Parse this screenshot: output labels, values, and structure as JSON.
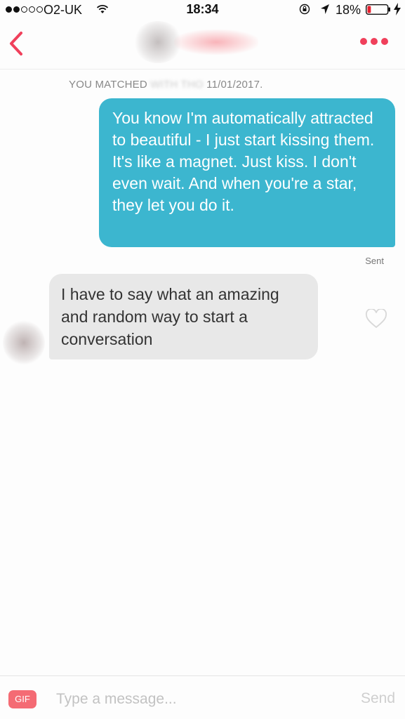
{
  "status_bar": {
    "carrier": "O2-UK",
    "time": "18:34",
    "battery_percent": "18%",
    "signal_strength": 2,
    "battery_level": 0.18
  },
  "header": {
    "back_icon": "chevron-left-icon",
    "more_icon": "more-dots-icon",
    "accent_color": "#f0405b"
  },
  "conversation": {
    "match_notice": {
      "prefix": "YOU MATCHED ",
      "obscured": "WITH THO",
      "date": " 11/01/2017."
    },
    "messages": [
      {
        "direction": "sent",
        "text": "You know I'm automatically attracted to beautiful - I just start kissing them. It's like a magnet. Just kiss. I don't even wait. And when you're a star, they let you do it.",
        "status": "Sent",
        "color": "#3cb6cf"
      },
      {
        "direction": "received",
        "text": "I have to say what an amazing and random way to start a conversation",
        "color": "#e8e8e8"
      }
    ]
  },
  "input_bar": {
    "gif_label": "GIF",
    "placeholder": "Type a message...",
    "value": "",
    "send_label": "Send"
  }
}
